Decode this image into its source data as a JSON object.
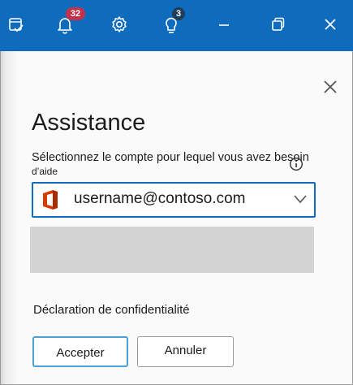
{
  "titlebar": {
    "notifications_count": "32",
    "ideas_count": "3",
    "icons": [
      "task-check-icon",
      "bell-icon",
      "gear-icon",
      "lightbulb-icon",
      "minimize-icon",
      "restore-icon",
      "close-icon"
    ],
    "accent_color": "#0f6cbd"
  },
  "dialog": {
    "title": "Assistance",
    "prompt_line1": "Sélectionnez le compte pour lequel vous avez besoin",
    "prompt_line2": "d’aide",
    "account_selected": "username@contoso.com",
    "privacy_label": "Déclaration de confidentialité",
    "accept_label": "Accepter",
    "cancel_label": "Annuler"
  }
}
